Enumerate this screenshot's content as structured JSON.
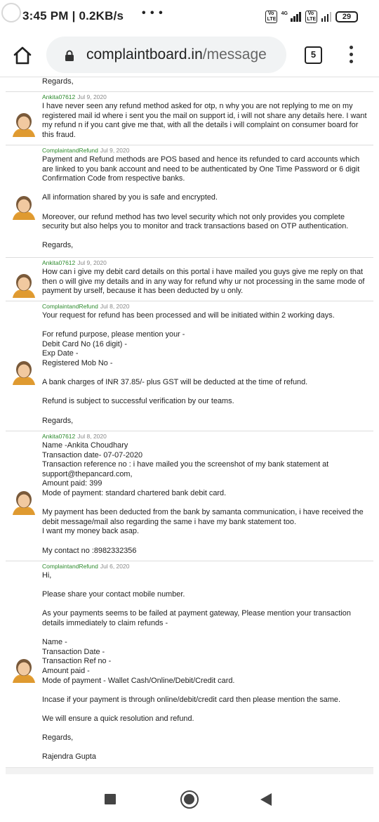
{
  "status_bar": {
    "time_speed": "3:45 PM | 0.2KB/s",
    "dots": "• • •",
    "volte1": "Vo LTE",
    "network": "4G",
    "volte2": "Vo LTE",
    "battery": "29"
  },
  "browser": {
    "url_host": "complaintboard.in",
    "url_path": "/message",
    "tab_count": "5"
  },
  "thread": {
    "top_regards": "Regards,",
    "messages": [
      {
        "author": "Ankita07612",
        "date": "Jul 9, 2020",
        "paragraphs": [
          "I have never seen any refund method asked for otp, n why you are not replying to me on my registered mail id where i sent you the mail on support id, i will not share any details here. I want my refund n if you cant give me that, with all the details i will complaint on consumer board for this fraud."
        ]
      },
      {
        "author": "ComplaintandRefund",
        "date": "Jul 9, 2020",
        "paragraphs": [
          "Payment and Refund methods are POS based and hence its refunded to card accounts which are linked to you bank account and need to be authenticated by One Time Password or 6 digit Confirmation Code from respective banks.",
          "",
          "All information shared by you is safe and encrypted.",
          "",
          "Moreover, our refund method has two level security which not only provides you complete security but also helps you to monitor and track transactions based on OTP authentication.",
          "",
          "Regards,"
        ]
      },
      {
        "author": "Ankita07612",
        "date": "Jul 9, 2020",
        "paragraphs": [
          "How can i give my debit card details on this portal i have mailed you guys give me reply on that then o will give my details and in any way for refund why ur not processing in the same mode of payment by urself, because it has been deducted by u only."
        ]
      },
      {
        "author": "ComplaintandRefund",
        "date": "Jul 8, 2020",
        "paragraphs": [
          "Your request for refund has been processed and will be initiated within 2 working days.",
          "",
          "For refund purpose, please mention your -\nDebit Card No (16 digit) -\nExp Date -\nRegistered Mob No -",
          "",
          "A bank charges of INR 37.85/- plus GST will be deducted at the time of refund.",
          "",
          "Refund is subject to successful verification by our teams.",
          "",
          "Regards,"
        ]
      },
      {
        "author": "Ankita07612",
        "date": "Jul 8, 2020",
        "paragraphs": [
          "Name -Ankita Choudhary\nTransaction date- 07-07-2020\nTransaction reference no : i have mailed you the screenshot of my bank statement at support@thepancard.com,\nAmount paid: 399\nMode of payment: standard chartered bank debit card.",
          "",
          "My payment has been deducted from the bank by samanta communication, i have received the debit message/mail also regarding the same i have my bank statement too.\nI want my money back asap.",
          "",
          "My contact no :8982332356"
        ]
      },
      {
        "author": "ComplaintandRefund",
        "date": "Jul 6, 2020",
        "paragraphs": [
          "Hi,",
          "",
          "Please share your contact mobile number.",
          "",
          "As your payments seems to be failed at payment gateway, Please mention your transaction details immediately to claim refunds -",
          "",
          "Name -\nTransaction Date -\nTransaction Ref no -\nAmount paid -\nMode of payment - Wallet Cash/Online/Debit/Credit card.",
          "",
          "Incase if your payment is through online/debit/credit card then please mention the same.",
          "",
          "We will ensure a quick resolution and refund.",
          "",
          "Regards,",
          "",
          "Rajendra Gupta"
        ]
      }
    ]
  }
}
